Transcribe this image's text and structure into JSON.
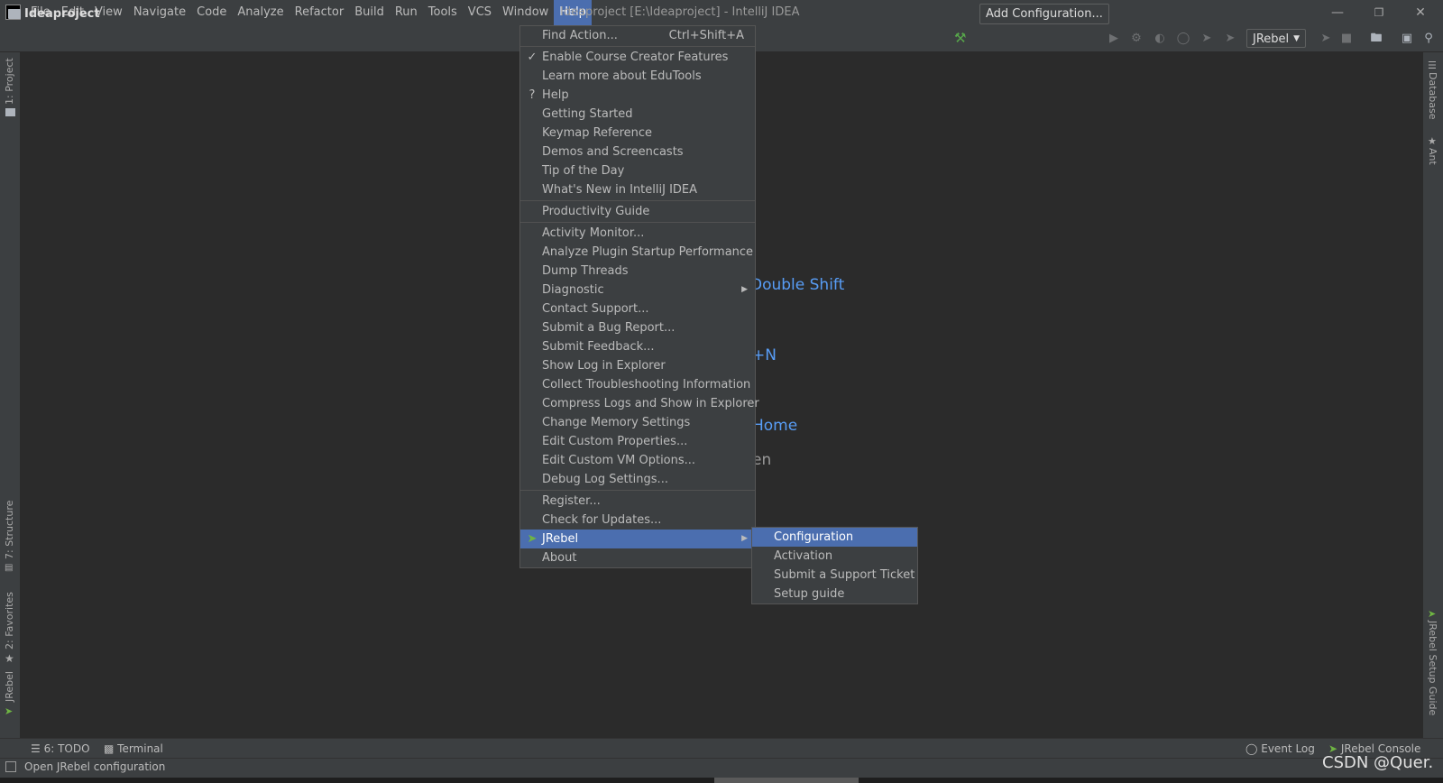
{
  "app": {
    "logo": "IJ",
    "window_title": "Ideaproject [E:\\Ideaproject] - IntelliJ IDEA"
  },
  "menubar": [
    {
      "label": "File"
    },
    {
      "label": "Edit"
    },
    {
      "label": "View"
    },
    {
      "label": "Navigate"
    },
    {
      "label": "Code"
    },
    {
      "label": "Analyze"
    },
    {
      "label": "Refactor"
    },
    {
      "label": "Build"
    },
    {
      "label": "Run"
    },
    {
      "label": "Tools"
    },
    {
      "label": "VCS"
    },
    {
      "label": "Window"
    },
    {
      "label": "Help",
      "active": true
    }
  ],
  "window_controls": {
    "minimize": "—",
    "restore": "❐",
    "close": "✕"
  },
  "navbar": {
    "project": "Ideaproject",
    "add_config": "Add Configuration...",
    "run_target": "JRebel"
  },
  "left_tabs": {
    "project": "1: Project",
    "structure": "7: Structure",
    "favorites": "2: Favorites",
    "jrebel": "JRebel"
  },
  "right_tabs": {
    "database": "Database",
    "ant": "Ant",
    "jrebel_guide": "JRebel Setup Guide"
  },
  "editor_hints": {
    "double_shift": "Double Shift",
    "n": "+N",
    "home": "Home",
    "en": "en"
  },
  "help_menu": {
    "groups": [
      [
        {
          "label": "Find Action...",
          "shortcut": "Ctrl+Shift+A"
        }
      ],
      [
        {
          "label": "Enable Course Creator Features",
          "lead": "✓"
        },
        {
          "label": "Learn more about EduTools"
        },
        {
          "label": "Help",
          "lead": "?"
        },
        {
          "label": "Getting Started"
        },
        {
          "label": "Keymap Reference"
        },
        {
          "label": "Demos and Screencasts"
        },
        {
          "label": "Tip of the Day"
        },
        {
          "label": "What's New in IntelliJ IDEA"
        }
      ],
      [
        {
          "label": "Productivity Guide"
        }
      ],
      [
        {
          "label": "Activity Monitor..."
        },
        {
          "label": "Analyze Plugin Startup Performance"
        },
        {
          "label": "Dump Threads"
        },
        {
          "label": "Diagnostic",
          "submenu": true
        },
        {
          "label": "Contact Support..."
        },
        {
          "label": "Submit a Bug Report..."
        },
        {
          "label": "Submit Feedback..."
        },
        {
          "label": "Show Log in Explorer"
        },
        {
          "label": "Collect Troubleshooting Information"
        },
        {
          "label": "Compress Logs and Show in Explorer"
        },
        {
          "label": "Change Memory Settings"
        },
        {
          "label": "Edit Custom Properties..."
        },
        {
          "label": "Edit Custom VM Options..."
        },
        {
          "label": "Debug Log Settings..."
        }
      ],
      [
        {
          "label": "Register..."
        },
        {
          "label": "Check for Updates..."
        },
        {
          "label": "JRebel",
          "submenu": true,
          "selected": true,
          "lead": "jrebel"
        },
        {
          "label": "About"
        }
      ]
    ]
  },
  "jrebel_submenu": [
    {
      "label": "Configuration",
      "selected": true
    },
    {
      "label": "Activation"
    },
    {
      "label": "Submit a Support Ticket"
    },
    {
      "label": "Setup guide"
    }
  ],
  "bottom_tabs": {
    "todo": "6: TODO",
    "terminal": "Terminal",
    "event_log": "Event Log",
    "jrebel_console": "JRebel Console"
  },
  "status": {
    "message": "Open JRebel configuration"
  },
  "watermark": "CSDN @Quer.",
  "colors": {
    "accent": "#4b6eaf",
    "link": "#589df6",
    "panel": "#3c3f41",
    "editor": "#2b2b2b"
  }
}
